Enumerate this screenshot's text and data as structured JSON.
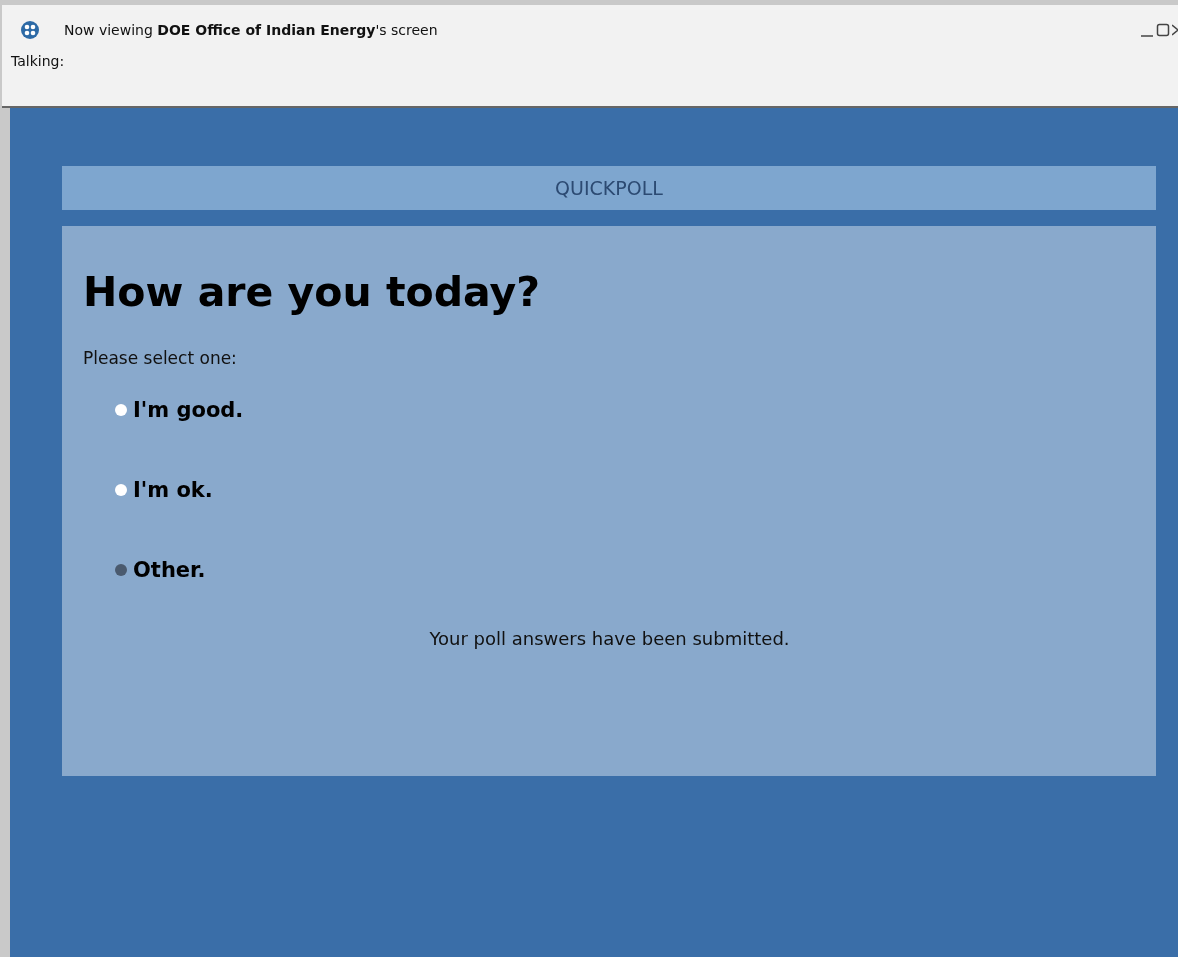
{
  "window": {
    "title": "Now viewing **DOE Office of Indian Energy**'s screen",
    "talking_label": "Talking:"
  },
  "poll": {
    "header": "QUICKPOLL",
    "question": "How are you today?",
    "instruction": "Please select one:",
    "options": [
      {
        "label": "I'm good.",
        "selected": false
      },
      {
        "label": "I'm ok.",
        "selected": false
      },
      {
        "label": "Other.",
        "selected": true
      }
    ],
    "status": "Your poll answers have been submitted."
  }
}
